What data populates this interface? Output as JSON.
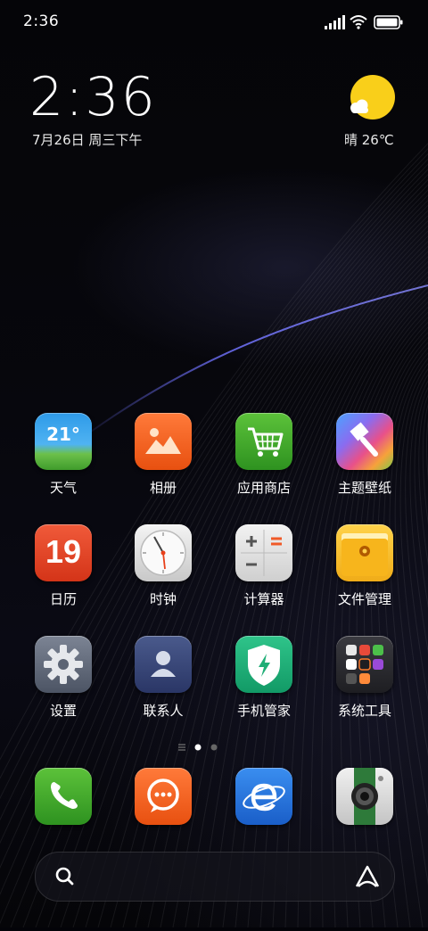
{
  "status_bar": {
    "time": "2:36"
  },
  "clock_widget": {
    "time": "2:36",
    "date": "7月26日 周三下午"
  },
  "weather_widget": {
    "summary": "晴 26℃",
    "icon": "sunny-icon"
  },
  "apps": {
    "weather": {
      "label": "天气",
      "tile_text": "21°"
    },
    "gallery": {
      "label": "相册"
    },
    "app_store": {
      "label": "应用商店"
    },
    "themes": {
      "label": "主题壁纸"
    },
    "calendar": {
      "label": "日历",
      "tile_text": "19"
    },
    "clock": {
      "label": "时钟"
    },
    "calculator": {
      "label": "计算器"
    },
    "file_manager": {
      "label": "文件管理"
    },
    "settings": {
      "label": "设置"
    },
    "contacts": {
      "label": "联系人"
    },
    "security": {
      "label": "手机管家"
    },
    "system_tools": {
      "label": "系统工具"
    }
  },
  "dock": [
    {
      "name": "phone",
      "icon": "phone-icon"
    },
    {
      "name": "messages",
      "icon": "message-icon"
    },
    {
      "name": "browser",
      "icon": "browser-icon"
    },
    {
      "name": "camera",
      "icon": "camera-icon"
    }
  ],
  "page_indicator": {
    "pages": 2,
    "current": 1
  },
  "colors": {
    "weather_sun": "#F9CF1A",
    "accent_line": "#6a6cf0"
  }
}
